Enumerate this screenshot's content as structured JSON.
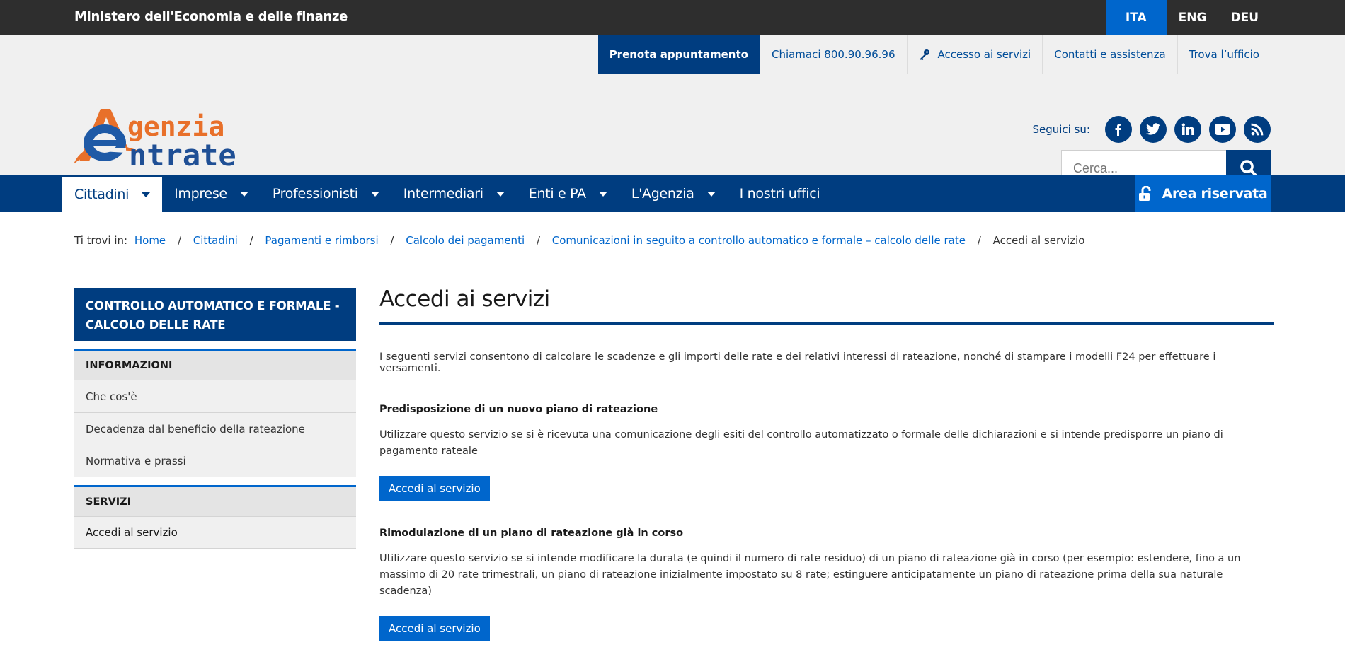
{
  "topbar": {
    "ministry": "Ministero dell'Economia e delle finanze",
    "languages": [
      "ITA",
      "ENG",
      "DEU"
    ],
    "active_language": "ITA"
  },
  "utility": {
    "book": "Prenota appuntamento",
    "call": "Chiamaci 800.90.96.96",
    "access": "Accesso ai servizi",
    "contacts": "Contatti e assistenza",
    "office": "Trova l’ufficio"
  },
  "logo": {
    "line1": "genzia",
    "line2": "ntrate",
    "icon": "agenzia-entrate-logo"
  },
  "social": {
    "label": "Seguici su:",
    "icons": [
      "facebook-icon",
      "twitter-icon",
      "linkedin-icon",
      "youtube-icon",
      "rss-icon"
    ]
  },
  "search": {
    "placeholder": "Cerca..."
  },
  "nav": {
    "items": [
      "Cittadini",
      "Imprese",
      "Professionisti",
      "Intermediari",
      "Enti e PA",
      "L'Agenzia",
      "I nostri uffici"
    ],
    "active": "Cittadini",
    "reserved": "Area riservata"
  },
  "breadcrumb": {
    "prefix": "Ti trovi in:",
    "links": [
      "Home",
      "Cittadini",
      "Pagamenti e rimborsi",
      "Calcolo dei pagamenti",
      "Comunicazioni in seguito a controllo automatico e formale – calcolo delle rate"
    ],
    "current": "Accedi al servizio"
  },
  "sidebar": {
    "title": "CONTROLLO AUTOMATICO E FORMALE - CALCOLO DELLE RATE",
    "section1": "INFORMAZIONI",
    "section1_items": [
      "Che cos'è",
      "Decadenza dal beneficio della rateazione",
      "Normativa e prassi"
    ],
    "section2": "SERVIZI",
    "section2_items": [
      "Accedi al servizio"
    ]
  },
  "main": {
    "title": "Accedi ai servizi",
    "intro": "I seguenti servizi consentono di calcolare le scadenze e gli importi delle rate e dei relativi interessi di rateazione, nonché di stampare i modelli F24 per effettuare i versamenti.",
    "service1_title": "Predisposizione di un nuovo piano di rateazione",
    "service1_desc": "Utilizzare questo servizio se si è ricevuta una comunicazione degli esiti del controllo automatizzato o formale delle dichiarazioni e si intende predisporre un piano di pagamento rateale",
    "service1_button": "Accedi al servizio",
    "service2_title": "Rimodulazione di un piano di rateazione già in corso",
    "service2_desc": "Utilizzare questo servizio se si intende modificare la durata (e quindi il numero di rate residuo) di un piano di rateazione già in corso (per esempio: estendere, fino a un massimo di 20 rate trimestrali, un piano di rateazione inizialmente impostato su 8 rate; estinguere anticipatamente un piano di rateazione prima della sua naturale scadenza)",
    "service2_button": "Accedi al servizio"
  },
  "colors": {
    "brand_blue": "#003d80",
    "accent_blue": "#0066cc",
    "logo_orange": "#e8702a"
  }
}
